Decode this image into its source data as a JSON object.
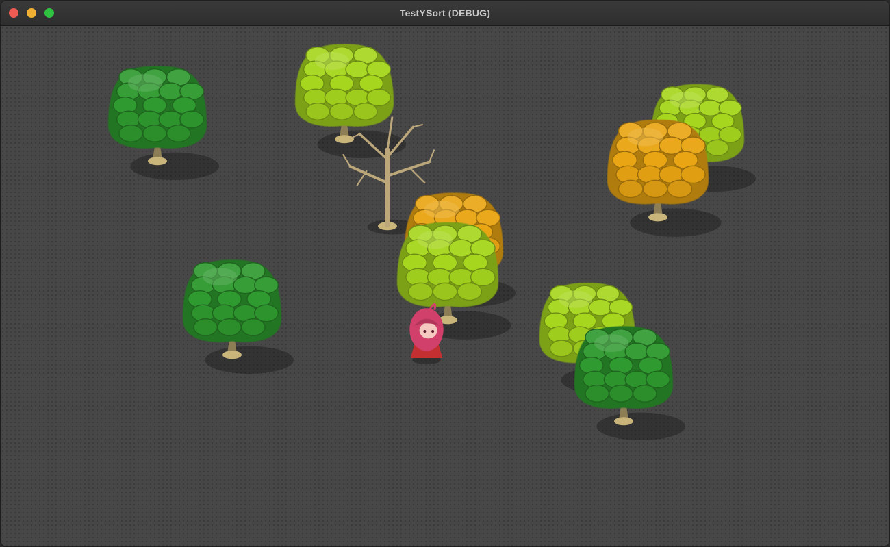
{
  "window": {
    "title": "TestYSort (DEBUG)",
    "controls": {
      "close_color": "#ed5b52",
      "minimize_color": "#f0b132",
      "maximize_color": "#2fc241"
    }
  },
  "scene": {
    "background_color": "#474747",
    "palette": {
      "dark_green": "#2f9a2f",
      "light_green": "#a6d61e",
      "orange": "#e9a514",
      "trunk": "#c9b47a",
      "bare_branch": "#bba77a"
    },
    "sprites": [
      {
        "kind": "tree",
        "color": "dark_green",
        "icon": "leafy-tree-icon"
      },
      {
        "kind": "tree",
        "color": "light_green",
        "icon": "leafy-tree-icon"
      },
      {
        "kind": "bare-tree",
        "color": "bare_branch",
        "icon": "bare-tree-icon"
      },
      {
        "kind": "tree",
        "color": "light_green",
        "icon": "leafy-tree-icon"
      },
      {
        "kind": "tree",
        "color": "orange",
        "icon": "leafy-tree-icon"
      },
      {
        "kind": "tree",
        "color": "orange",
        "icon": "leafy-tree-icon"
      },
      {
        "kind": "tree",
        "color": "light_green",
        "icon": "leafy-tree-icon"
      },
      {
        "kind": "tree",
        "color": "dark_green",
        "icon": "leafy-tree-icon"
      },
      {
        "kind": "player",
        "color": "#d0406a",
        "icon": "pink-haired-character-icon"
      },
      {
        "kind": "tree",
        "color": "light_green",
        "icon": "leafy-tree-icon"
      },
      {
        "kind": "tree",
        "color": "dark_green",
        "icon": "leafy-tree-icon"
      }
    ]
  }
}
